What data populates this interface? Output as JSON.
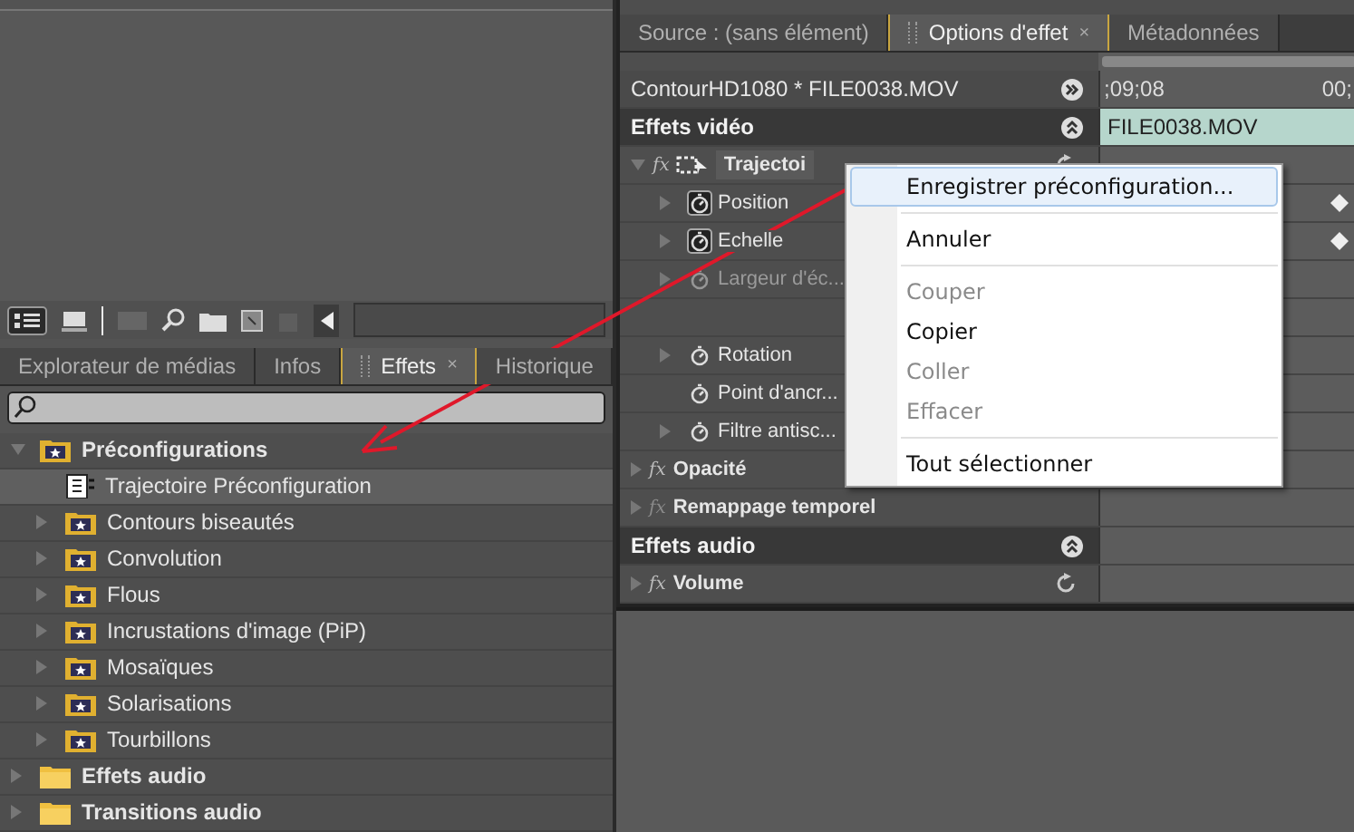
{
  "effects_panel": {
    "tabs": [
      {
        "label": "Explorateur de médias",
        "selected": false
      },
      {
        "label": "Infos",
        "selected": false
      },
      {
        "label": "Effets",
        "selected": true,
        "close_glyph": "×"
      },
      {
        "label": "Historique",
        "selected": false
      }
    ],
    "tree": [
      {
        "label": "Préconfigurations",
        "kind": "folder",
        "expanded": true,
        "children": [
          {
            "label": "Trajectoire Préconfiguration",
            "kind": "preset",
            "selected": true
          },
          {
            "label": "Contours biseautés",
            "kind": "folder",
            "expanded": false
          },
          {
            "label": "Convolution",
            "kind": "folder",
            "expanded": false
          },
          {
            "label": "Flous",
            "kind": "folder",
            "expanded": false
          },
          {
            "label": "Incrustations d'image (PiP)",
            "kind": "folder",
            "expanded": false
          },
          {
            "label": "Mosaïques",
            "kind": "folder",
            "expanded": false
          },
          {
            "label": "Solarisations",
            "kind": "folder",
            "expanded": false
          },
          {
            "label": "Tourbillons",
            "kind": "folder",
            "expanded": false
          }
        ]
      },
      {
        "label": "Effets audio",
        "kind": "plain_folder",
        "expanded": false
      },
      {
        "label": "Transitions audio",
        "kind": "plain_folder",
        "expanded": false
      }
    ]
  },
  "effect_options": {
    "tabs": [
      {
        "label": "Source : (sans élément)",
        "selected": false
      },
      {
        "label": "Options d'effet",
        "selected": true,
        "close_glyph": "×"
      },
      {
        "label": "Métadonnées",
        "selected": false
      }
    ],
    "clip_header": "ContourHD1080 * FILE0038.MOV",
    "timecode": ";09;08",
    "timecode_next": "00;",
    "clip_bar": "FILE0038.MOV",
    "rows": [
      {
        "kind": "section",
        "label": "Effets vidéo"
      },
      {
        "kind": "effect",
        "label": "Trajectoi",
        "badge": "fx",
        "fx_enabled": true,
        "expanded": true,
        "reset": true
      },
      {
        "kind": "property",
        "label": "Position",
        "expandable": true,
        "animated": true,
        "disabled": false,
        "keyframe": true
      },
      {
        "kind": "property",
        "label": "Echelle",
        "expandable": true,
        "animated": true,
        "disabled": false,
        "keyframe": true
      },
      {
        "kind": "property",
        "label": "Largeur d'éc...",
        "expandable": true,
        "animated": false,
        "disabled": true,
        "keyframe": false
      },
      {
        "kind": "spacer"
      },
      {
        "kind": "property",
        "label": "Rotation",
        "expandable": true,
        "animated": false,
        "disabled": false,
        "keyframe": false
      },
      {
        "kind": "property",
        "label": "Point d'ancr...",
        "expandable": false,
        "animated": false,
        "disabled": false,
        "keyframe": false
      },
      {
        "kind": "property",
        "label": "Filtre antisc...",
        "expandable": true,
        "animated": false,
        "disabled": false,
        "keyframe": false
      },
      {
        "kind": "effect",
        "label": "Opacité",
        "badge": "fx",
        "fx_enabled": true,
        "expanded": false,
        "reset": false
      },
      {
        "kind": "effect",
        "label": "Remappage temporel",
        "badge": "fx",
        "fx_enabled": false,
        "expanded": false,
        "reset": false
      },
      {
        "kind": "section",
        "label": "Effets audio"
      },
      {
        "kind": "effect",
        "label": "Volume",
        "badge": "fx",
        "fx_enabled": true,
        "expanded": false,
        "reset": true
      }
    ]
  },
  "context_menu": [
    {
      "kind": "item",
      "label": "Enregistrer préconfiguration...",
      "disabled": false,
      "selected": true
    },
    {
      "kind": "separator"
    },
    {
      "kind": "item",
      "label": "Annuler",
      "disabled": false,
      "selected": false
    },
    {
      "kind": "separator"
    },
    {
      "kind": "item",
      "label": "Couper",
      "disabled": true,
      "selected": false
    },
    {
      "kind": "item",
      "label": "Copier",
      "disabled": false,
      "selected": false
    },
    {
      "kind": "item",
      "label": "Coller",
      "disabled": true,
      "selected": false
    },
    {
      "kind": "item",
      "label": "Effacer",
      "disabled": true,
      "selected": false
    },
    {
      "kind": "separator"
    },
    {
      "kind": "item",
      "label": "Tout sélectionner",
      "disabled": false,
      "selected": false
    }
  ]
}
